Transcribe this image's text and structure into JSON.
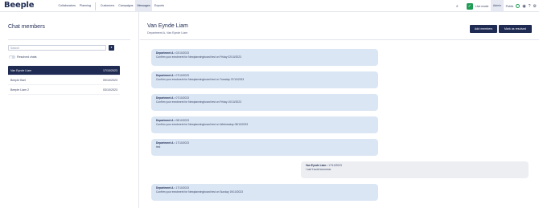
{
  "app": {
    "logo": "Beeple"
  },
  "nav": {
    "left": [
      "Collaborators",
      "Planning"
    ],
    "middle": [
      "Customers",
      "Campaigns",
      "Messages",
      "Exports"
    ],
    "active": "Messages"
  },
  "topright": {
    "live_label": "Live mode",
    "admin_label": "Admin",
    "public_label": "Public"
  },
  "sidebar": {
    "title": "Chat members",
    "search_placeholder": "Search",
    "resolved_label": "Resolved chats",
    "chats": [
      {
        "name": "Van Eynde Liam",
        "date": "17/10/2023",
        "active": true
      },
      {
        "name": "Beeple Bart",
        "date": "09/10/2023",
        "active": false
      },
      {
        "name": "Beeple Liam 2",
        "date": "03/10/2023",
        "active": false
      }
    ]
  },
  "conversation": {
    "title": "Van Eynde Liam",
    "subtitle": "Department A, Van Eynde Liam",
    "add_members_label": "Add members",
    "mark_resolved_label": "Mark as resolved",
    "messages": [
      {
        "direction": "in",
        "sender": "Department A",
        "date": "02/10/2023",
        "text": "Confirm your enrolment for Newplanningboard test on Friday 02/10/2023"
      },
      {
        "direction": "in",
        "sender": "Department A",
        "date": "07/10/2023",
        "text": "Confirm your enrolment for Newplanningboard test on Tuesday 07/10/2023"
      },
      {
        "direction": "in",
        "sender": "Department A",
        "date": "07/10/2023",
        "text": "Confirm your enrolment for Newplanningboard test on Friday 10/10/2023"
      },
      {
        "direction": "in",
        "sender": "Department A",
        "date": "08/10/2023",
        "text": "Confirm your enrolment for Newplanningboard test on Wednesday 08/10/2023"
      },
      {
        "direction": "in",
        "sender": "Department A",
        "date": "17/10/2023",
        "text": "test"
      },
      {
        "direction": "out",
        "sender": "Van Eynde Liam",
        "date": "17/10/2023",
        "text": "I can't work tomorrow"
      },
      {
        "direction": "in",
        "sender": "Department A",
        "date": "17/10/2023",
        "text": "Confirm your enrolment for Newplanningboard test on Sunday 19/10/2023"
      }
    ]
  }
}
